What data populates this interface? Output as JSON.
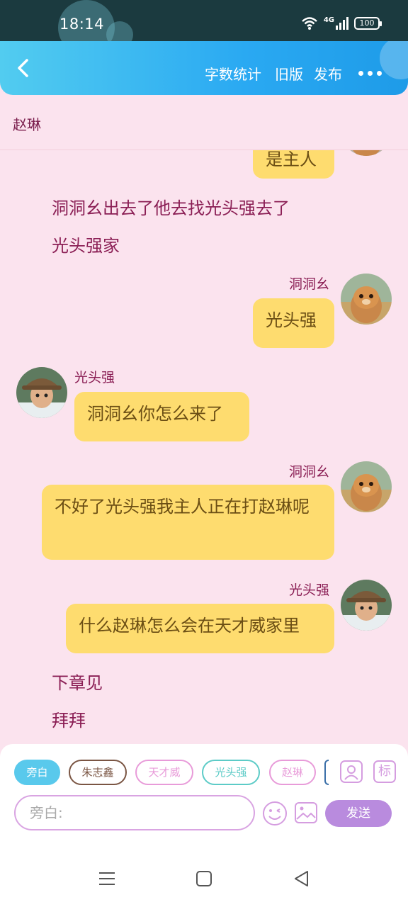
{
  "status": {
    "time": "18:14",
    "network": "4G",
    "battery": "100"
  },
  "header": {
    "nav_items": [
      "字数统计",
      "旧版",
      "发布"
    ]
  },
  "chapter": {
    "title": "赵琳"
  },
  "messages": {
    "m0_text": "是主人",
    "n1": "洞洞幺出去了他去找光头强去了",
    "n2": "光头强家",
    "m1_sender": "洞洞幺",
    "m1_text": "光头强",
    "m2_sender": "光头强",
    "m2_text": "洞洞幺你怎么来了",
    "m3_sender": "洞洞幺",
    "m3_text": "不好了光头强我主人正在打赵琳呢",
    "m4_sender": "光头强",
    "m4_text": "什么赵琳怎么会在天才威家里",
    "n3": "下章见",
    "n4": "拜拜"
  },
  "characters": [
    {
      "label": "旁白",
      "color": "#59c9ec"
    },
    {
      "label": "朱志鑫",
      "color": "#7a5543"
    },
    {
      "label": "天才威",
      "color": "#e89bd9"
    },
    {
      "label": "光头强",
      "color": "#5ccbc7"
    },
    {
      "label": "赵琳",
      "color": "#e89bd9"
    }
  ],
  "input": {
    "placeholder": "旁白:",
    "send_label": "发送",
    "tag_icon_label": "标"
  },
  "colors": {
    "header_start": "#52ccf0",
    "header_end": "#1e9be8",
    "background": "#fbe3ee",
    "bubble": "#fedc6f",
    "accent": "#b98bde"
  },
  "icons": [
    "wifi-icon",
    "signal-icon",
    "battery-icon",
    "back-icon",
    "more-icon",
    "contact-icon",
    "emoji-icon",
    "image-icon",
    "menu-icon",
    "home-icon",
    "nav-back-icon"
  ]
}
